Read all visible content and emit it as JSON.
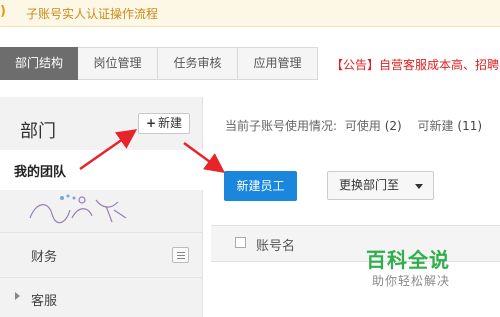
{
  "notice": {
    "icon": ")",
    "text": "子账号实人认证操作流程"
  },
  "tabs": [
    {
      "label": "部门结构",
      "active": true
    },
    {
      "label": "岗位管理",
      "active": false
    },
    {
      "label": "任务审核",
      "active": false
    },
    {
      "label": "应用管理",
      "active": false
    }
  ],
  "announcement": "【公告】自营客服成本高、招聘",
  "sidebar": {
    "title": "部门",
    "new_button": {
      "icon": "+",
      "label": "新建"
    },
    "team_label": "我的团队",
    "items": [
      {
        "label": "财务"
      },
      {
        "label": "客服"
      }
    ]
  },
  "main": {
    "usage_prefix": "当前子账号使用情况:",
    "usage_available_label": "可使用",
    "usage_available_value": "(2)",
    "usage_new_label": "可新建",
    "usage_new_value": "(11)",
    "new_employee_button": "新建员工",
    "change_dept_button": "更换部门至",
    "table_header": "账号名"
  },
  "watermark": {
    "title": "百科全说",
    "subtitle": "助你轻松解决"
  },
  "colors": {
    "primary": "#1a86dc",
    "annotation_arrow": "#e8232a",
    "announcement": "#e02020",
    "watermark_green": "#2fae4a"
  }
}
